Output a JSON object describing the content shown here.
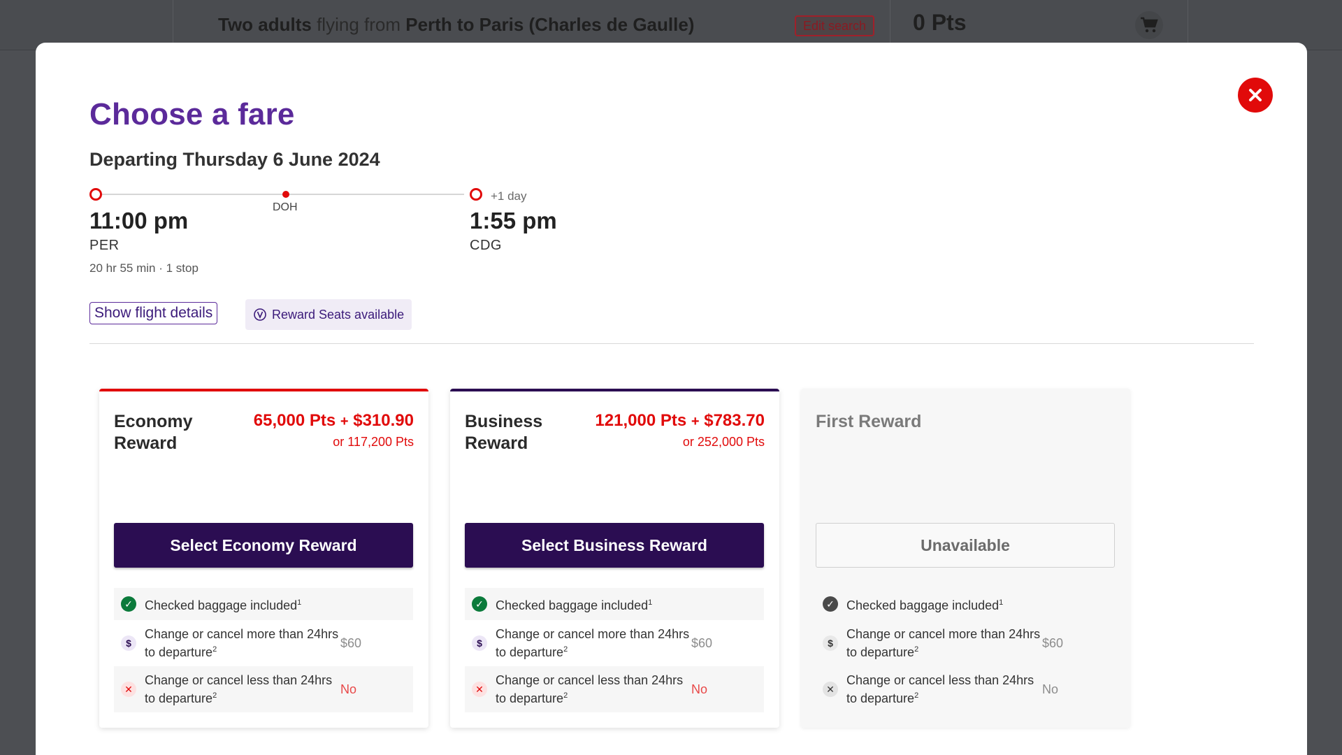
{
  "header": {
    "search_prefix": "Two adults",
    "search_middle": " flying from ",
    "search_route": "Perth to Paris (Charles de Gaulle)",
    "edit_label": "Edit search",
    "points": "0 Pts"
  },
  "modal": {
    "title": "Choose a fare",
    "departing": "Departing Thursday 6 June 2024",
    "flight": {
      "depart_time": "11:00 pm",
      "depart_code": "PER",
      "stop_code": "DOH",
      "arrive_time": "1:55 pm",
      "arrive_code": "CDG",
      "plus_day": "+1 day",
      "duration": "20 hr 55 min · 1 stop"
    },
    "show_details_label": "Show flight details",
    "reward_seats_label": "Reward Seats available"
  },
  "fares": [
    {
      "name": "Economy Reward",
      "price_pts": "65,000 Pts",
      "price_plus": "+",
      "price_cash": "$310.90",
      "alt_price": "or 117,200 Pts",
      "button": "Select Economy Reward",
      "features": {
        "baggage": "Checked baggage included",
        "baggage_sup": "1",
        "change_more": "Change or cancel more than 24hrs to departure",
        "change_more_sup": "2",
        "change_more_value": "$60",
        "change_less": "Change or cancel less than 24hrs to departure",
        "change_less_sup": "2",
        "change_less_value": "No"
      }
    },
    {
      "name": "Business Reward",
      "price_pts": "121,000 Pts",
      "price_plus": "+",
      "price_cash": "$783.70",
      "alt_price": "or 252,000 Pts",
      "button": "Select Business Reward",
      "features": {
        "baggage": "Checked baggage included",
        "baggage_sup": "1",
        "change_more": "Change or cancel more than 24hrs to departure",
        "change_more_sup": "2",
        "change_more_value": "$60",
        "change_less": "Change or cancel less than 24hrs to departure",
        "change_less_sup": "2",
        "change_less_value": "No"
      }
    },
    {
      "name": "First Reward",
      "button": "Unavailable",
      "features": {
        "baggage": "Checked baggage included",
        "baggage_sup": "1",
        "change_more": "Change or cancel more than 24hrs to departure",
        "change_more_sup": "2",
        "change_more_value": "$60",
        "change_less": "Change or cancel less than 24hrs to departure",
        "change_less_sup": "2",
        "change_less_value": "No"
      }
    }
  ],
  "icons": {
    "close": "close-icon",
    "cart": "cart-icon",
    "reward": "reward-seat-icon",
    "check": "check-circle-icon",
    "dollar": "dollar-icon",
    "cross": "cross-icon"
  },
  "colors": {
    "brand_purple": "#5b2a9a",
    "dark_purple": "#2b0d52",
    "accent_red": "#e10a0a",
    "success_green": "#0b7a3b"
  }
}
